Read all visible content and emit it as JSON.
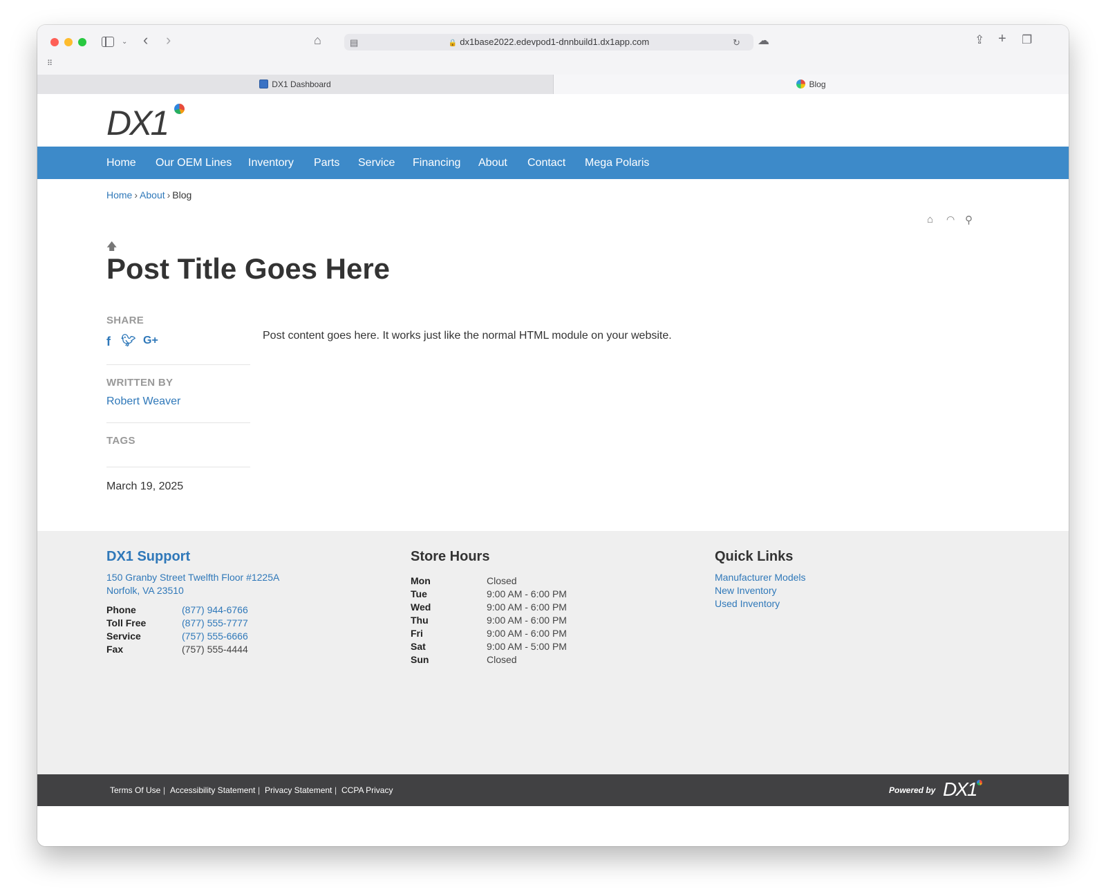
{
  "browser": {
    "url": "dx1base2022.edevpod1-dnnbuild1.dx1app.com",
    "tabs": [
      {
        "label": "DX1 Dashboard"
      },
      {
        "label": "Blog"
      }
    ]
  },
  "site": {
    "logo_text": "DX1",
    "nav": [
      "Home",
      "Our OEM Lines",
      "Inventory",
      "Parts",
      "Service",
      "Financing",
      "About",
      "Contact",
      "Mega Polaris"
    ],
    "accent_color": "#3d8ac9"
  },
  "breadcrumb": {
    "home": "Home",
    "about": "About",
    "current": "Blog",
    "separator": "›"
  },
  "post": {
    "title": "Post Title Goes Here",
    "share_label": "SHARE",
    "written_by_label": "WRITTEN BY",
    "author": "Robert Weaver",
    "tags_label": "TAGS",
    "date": "March 19, 2025",
    "content": "Post content goes here.  It works just like the normal HTML module on your website."
  },
  "footer": {
    "support": {
      "heading": "DX1 Support",
      "address_line1": "150 Granby Street Twelfth Floor #1225A",
      "address_line2": "Norfolk, VA 23510",
      "contacts": [
        {
          "label": "Phone",
          "value": "(877) 944-6766"
        },
        {
          "label": "Toll Free",
          "value": "(877) 555-7777"
        },
        {
          "label": "Service",
          "value": "(757) 555-6666"
        },
        {
          "label": "Fax",
          "value": "(757) 555-4444"
        }
      ]
    },
    "hours": {
      "heading": "Store Hours",
      "rows": [
        {
          "day": "Mon",
          "time": "Closed"
        },
        {
          "day": "Tue",
          "time": "9:00 AM - 6:00 PM"
        },
        {
          "day": "Wed",
          "time": "9:00 AM - 6:00 PM"
        },
        {
          "day": "Thu",
          "time": "9:00 AM - 6:00 PM"
        },
        {
          "day": "Fri",
          "time": "9:00 AM - 6:00 PM"
        },
        {
          "day": "Sat",
          "time": "9:00 AM - 5:00 PM"
        },
        {
          "day": "Sun",
          "time": "Closed"
        }
      ]
    },
    "quick_links": {
      "heading": "Quick Links",
      "links": [
        "Manufacturer Models",
        "New Inventory",
        "Used Inventory"
      ]
    }
  },
  "bottom_bar": {
    "links": [
      "Terms Of Use",
      "Accessibility Statement",
      "Privacy Statement",
      "CCPA Privacy"
    ],
    "separator": "|",
    "powered_by": "Powered by",
    "powered_logo": "DX1"
  }
}
